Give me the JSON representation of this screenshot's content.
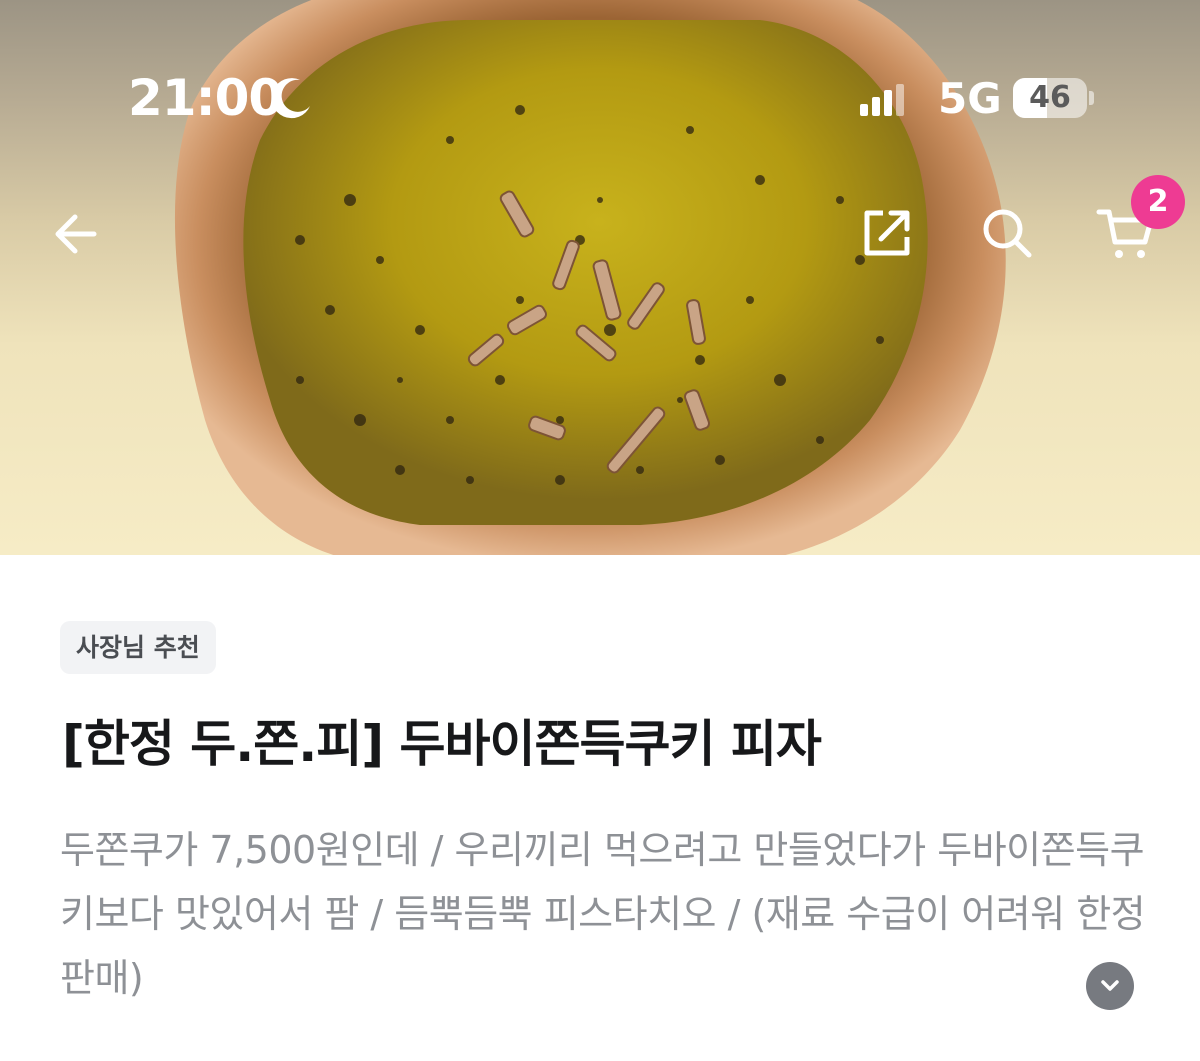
{
  "status_bar": {
    "time": "21:00",
    "network": "5G",
    "battery": "46",
    "battery_level": 0.46
  },
  "nav": {
    "back_icon": "arrow-left-icon",
    "share_icon": "share-icon",
    "search_icon": "search-icon",
    "cart_icon": "cart-icon",
    "cart_count": "2",
    "badge_color": "#ee3b93"
  },
  "product": {
    "image_alt_icon": "pizza-photo",
    "tag": "사장님 추천",
    "title": "[한정 두.쫀.피] 두바이쫀득쿠키 피자",
    "description": "두쫀쿠가 7,500원인데 / 우리끼리 먹으려고 만들었다가 두바이쫀득쿠키보다 맛있어서 팜 / 듬뿍듬뿍 피스타치오 / (재료 수급이 어려워 한정 판매)",
    "expand_icon": "chevron-down-icon"
  }
}
